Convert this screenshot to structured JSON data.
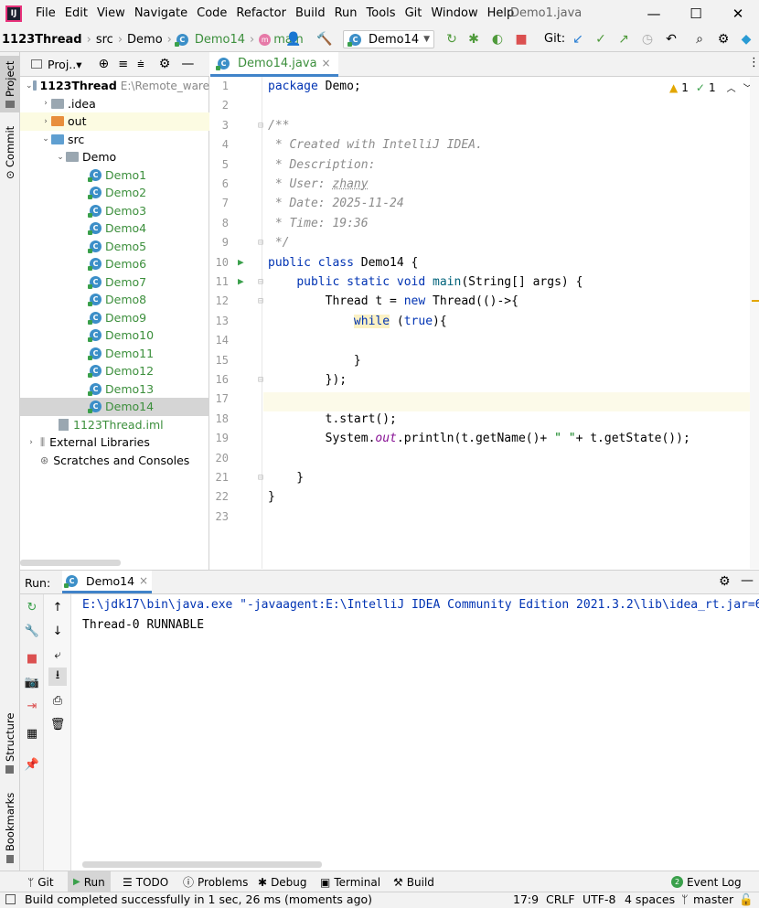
{
  "menubar": {
    "logo_text": "IJ",
    "items": [
      "File",
      "Edit",
      "View",
      "Navigate",
      "Code",
      "Refactor",
      "Build",
      "Run",
      "Tools",
      "Git",
      "Window",
      "Help"
    ],
    "window_title": "Demo1.java",
    "minimize": "—",
    "maximize": "☐",
    "close": "✕"
  },
  "navbar": {
    "breadcrumbs": [
      "1123Thread",
      "src",
      "Demo",
      "Demo14",
      "main"
    ],
    "run_config": "Demo14",
    "git_label": "Git:"
  },
  "project": {
    "header_label": "Proj..▾",
    "rows": [
      {
        "label": "1123Thread",
        "note": "E:\\Remote_ware"
      },
      {
        "label": ".idea"
      },
      {
        "label": "out"
      },
      {
        "label": "src"
      },
      {
        "label": "Demo"
      },
      {
        "label": "Demo1"
      },
      {
        "label": "Demo2"
      },
      {
        "label": "Demo3"
      },
      {
        "label": "Demo4"
      },
      {
        "label": "Demo5"
      },
      {
        "label": "Demo6"
      },
      {
        "label": "Demo7"
      },
      {
        "label": "Demo8"
      },
      {
        "label": "Demo9"
      },
      {
        "label": "Demo10"
      },
      {
        "label": "Demo11"
      },
      {
        "label": "Demo12"
      },
      {
        "label": "Demo13"
      },
      {
        "label": "Demo14"
      },
      {
        "label": "1123Thread.iml"
      },
      {
        "label": "External Libraries"
      },
      {
        "label": "Scratches and Consoles"
      }
    ]
  },
  "left_strip": {
    "project": "Project",
    "commit": "Commit",
    "structure": "Structure",
    "bookmarks": "Bookmarks"
  },
  "editor": {
    "tab_label": "Demo14.java",
    "tab_close": "×",
    "warnings": "1",
    "checks": "1",
    "line_numbers": [
      "1",
      "2",
      "3",
      "4",
      "5",
      "6",
      "7",
      "8",
      "9",
      "10",
      "11",
      "12",
      "13",
      "14",
      "15",
      "16",
      "17",
      "18",
      "19",
      "20",
      "21",
      "22",
      "23"
    ],
    "code": {
      "l1_kw": "package",
      "l1_rest": " Demo;",
      "l3": "/**",
      "l4": " * Created with IntelliJ IDEA.",
      "l5": " * Description:",
      "l6a": " * User: ",
      "l6b": "zhany",
      "l7": " * Date: 2025-11-24",
      "l8": " * Time: 19:36",
      "l9": " */",
      "l10_kw": "public class",
      "l10_rest": " Demo14 {",
      "l11_indent": "    ",
      "l11_kw": "public static void",
      "l11_fn": " main",
      "l11_rest": "(String[] args) {",
      "l12_a": "        Thread t = ",
      "l12_kw": "new",
      "l12_b": " Thread(()->{",
      "l13_indent": "            ",
      "l13_kw": "while",
      "l13_sp": " (",
      "l13_kw2": "true",
      "l13_rest": "){",
      "l15": "            }",
      "l16": "        });",
      "l18": "        t.start();",
      "l19_a": "        System.",
      "l19_fld": "out",
      "l19_b": ".println(t.getName()+ ",
      "l19_st": "\" \"",
      "l19_c": "+ t.getState());",
      "l21": "    }",
      "l22": "}"
    }
  },
  "run": {
    "label": "Run:",
    "tab": "Demo14",
    "tab_close": "×",
    "console_lines": [
      "E:\\jdk17\\bin\\java.exe \"-javaagent:E:\\IntelliJ IDEA Community Edition 2021.3.2\\lib\\idea_rt.jar=6",
      "Thread-0 RUNNABLE"
    ]
  },
  "bottom_tools": [
    "Git",
    "Run",
    "TODO",
    "Problems",
    "Debug",
    "Terminal",
    "Build",
    "Event Log"
  ],
  "status": {
    "message": "Build completed successfully in 1 sec, 26 ms (moments ago)",
    "position": "17:9",
    "line_sep": "CRLF",
    "encoding": "UTF-8",
    "indent": "4 spaces",
    "branch": "master"
  }
}
